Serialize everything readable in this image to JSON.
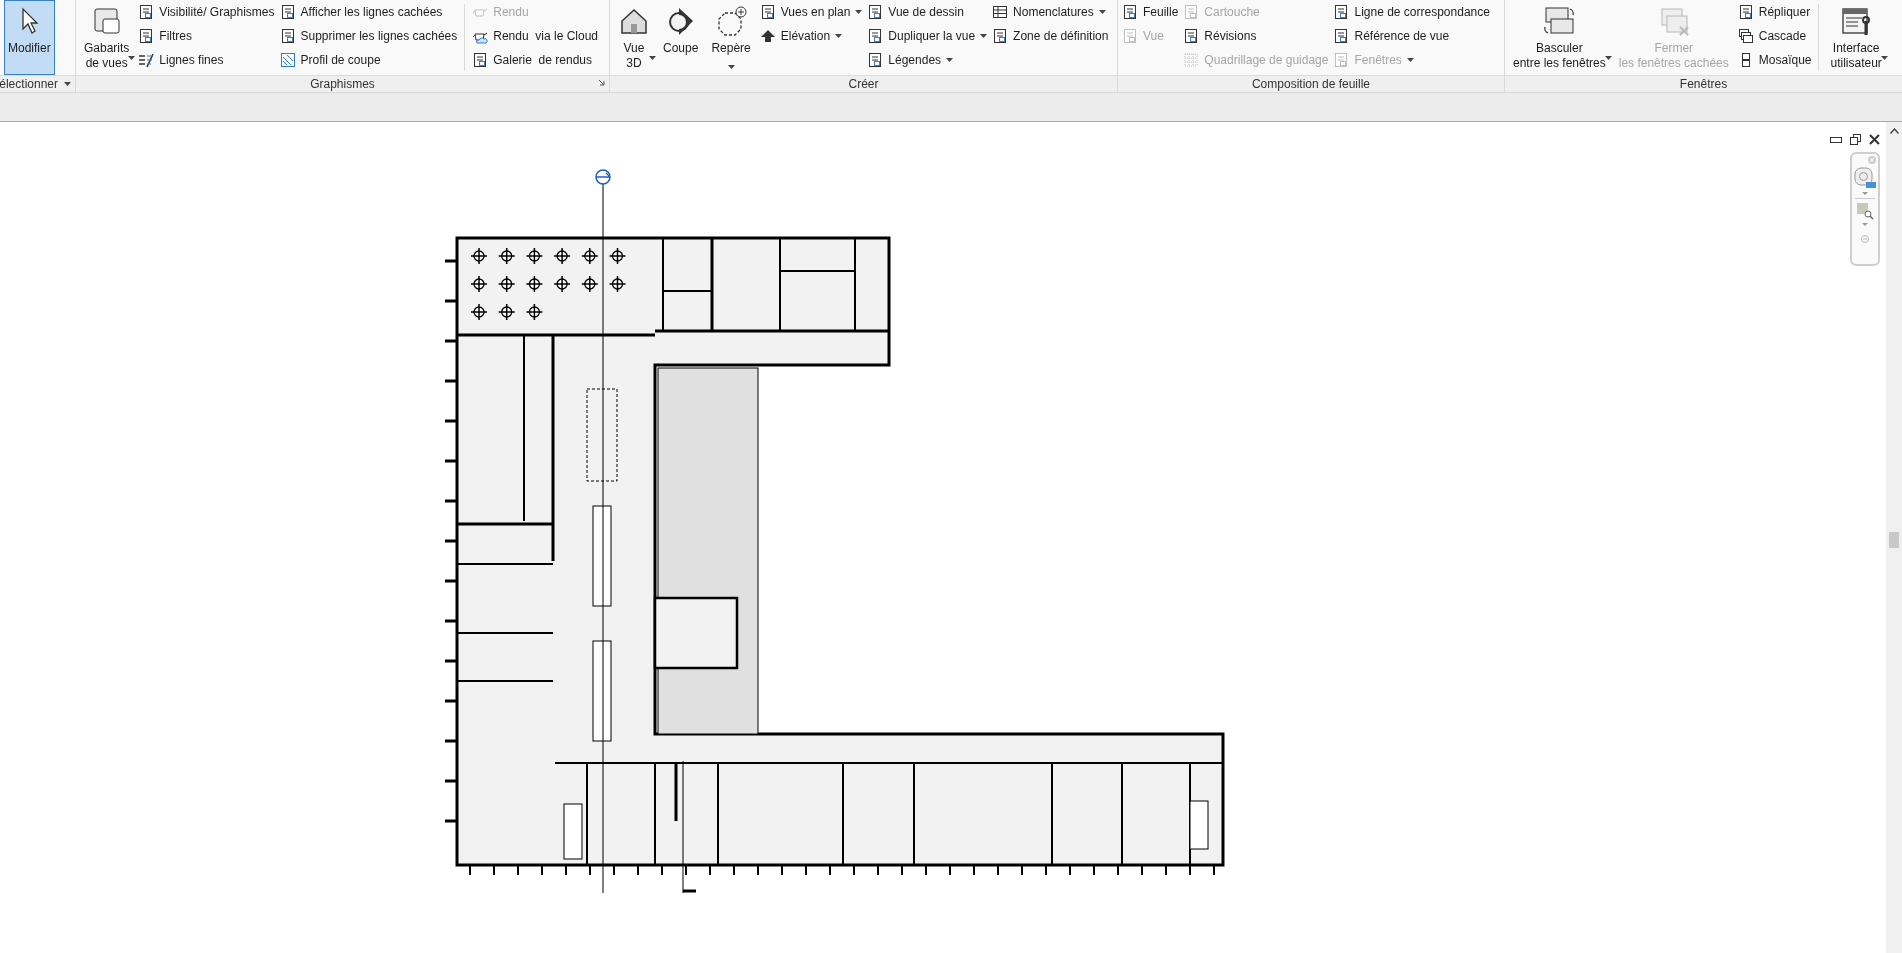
{
  "ribbon": {
    "panels": [
      {
        "title": "électionner",
        "menu": true,
        "launcher": false,
        "columns": [
          {
            "kind": "large",
            "selected": true,
            "disabled": false,
            "dropdown": false,
            "lines": [
              "Modifier"
            ]
          }
        ]
      },
      {
        "title": "Graphismes",
        "menu": false,
        "launcher": true,
        "columns": [
          {
            "kind": "large",
            "selected": false,
            "disabled": false,
            "dropdown": true,
            "lines": [
              "Gabarits",
              "de vues"
            ]
          },
          {
            "kind": "stack",
            "items": [
              {
                "label": "Visibilité/ Graphismes",
                "disabled": false,
                "dropdown": false
              },
              {
                "label": "Filtres",
                "disabled": false,
                "dropdown": false
              },
              {
                "label": "Lignes fines",
                "disabled": false,
                "dropdown": false
              }
            ]
          },
          {
            "kind": "stack",
            "items": [
              {
                "label": "Afficher les lignes cachées",
                "disabled": false,
                "dropdown": false
              },
              {
                "label": "Supprimer les lignes cachées",
                "disabled": false,
                "dropdown": false
              },
              {
                "label": "Profil de coupe",
                "disabled": false,
                "dropdown": false
              }
            ]
          },
          {
            "kind": "separator"
          },
          {
            "kind": "stack",
            "items": [
              {
                "label": "Rendu",
                "disabled": true,
                "dropdown": false
              },
              {
                "label": "Rendu  via le Cloud",
                "disabled": false,
                "dropdown": false
              },
              {
                "label": "Galerie  de rendus",
                "disabled": false,
                "dropdown": false
              }
            ]
          }
        ]
      },
      {
        "title": "Créer",
        "menu": false,
        "launcher": false,
        "columns": [
          {
            "kind": "large",
            "selected": false,
            "disabled": false,
            "dropdown": true,
            "lines": [
              "Vue",
              "3D"
            ]
          },
          {
            "kind": "large",
            "selected": false,
            "disabled": false,
            "dropdown": false,
            "lines": [
              "Coupe"
            ]
          },
          {
            "kind": "large",
            "selected": false,
            "disabled": false,
            "dropdown": true,
            "lines": [
              "Repère"
            ]
          },
          {
            "kind": "stack",
            "items": [
              {
                "label": "Vues en plan",
                "disabled": false,
                "dropdown": true
              },
              {
                "label": "Elévation",
                "disabled": false,
                "dropdown": true
              }
            ]
          },
          {
            "kind": "stack",
            "items": [
              {
                "label": "Vue de dessin",
                "disabled": false,
                "dropdown": false
              },
              {
                "label": "Dupliquer la vue",
                "disabled": false,
                "dropdown": true
              },
              {
                "label": "Légendes",
                "disabled": false,
                "dropdown": true
              }
            ]
          },
          {
            "kind": "stack",
            "items": [
              {
                "label": "Nomenclatures",
                "disabled": false,
                "dropdown": true
              },
              {
                "label": "Zone de définition",
                "disabled": false,
                "dropdown": false
              }
            ]
          }
        ]
      },
      {
        "title": "Composition de feuille",
        "menu": false,
        "launcher": false,
        "columns": [
          {
            "kind": "stack",
            "items": [
              {
                "label": "Feuille",
                "disabled": false,
                "dropdown": false
              },
              {
                "label": "Vue",
                "disabled": true,
                "dropdown": false
              }
            ]
          },
          {
            "kind": "stack",
            "items": [
              {
                "label": "Cartouche",
                "disabled": true,
                "dropdown": false
              },
              {
                "label": "Révisions",
                "disabled": false,
                "dropdown": false
              },
              {
                "label": "Quadrillage de guidage",
                "disabled": true,
                "dropdown": false
              }
            ]
          },
          {
            "kind": "stack",
            "items": [
              {
                "label": "Ligne de correspondance",
                "disabled": false,
                "dropdown": false
              },
              {
                "label": "Référence de vue",
                "disabled": false,
                "dropdown": false
              },
              {
                "label": "Fenêtres",
                "disabled": true,
                "dropdown": true
              }
            ]
          }
        ]
      },
      {
        "title": "Fenêtres",
        "menu": false,
        "launcher": false,
        "columns": [
          {
            "kind": "large",
            "selected": false,
            "disabled": false,
            "dropdown": true,
            "lines": [
              "Basculer",
              "entre les fenêtres"
            ]
          },
          {
            "kind": "large",
            "selected": false,
            "disabled": true,
            "dropdown": false,
            "lines": [
              "Fermer",
              "les fenêtres cachées"
            ]
          },
          {
            "kind": "stack",
            "items": [
              {
                "label": "Répliquer",
                "disabled": false,
                "dropdown": false
              },
              {
                "label": "Cascade",
                "disabled": false,
                "dropdown": false
              },
              {
                "label": "Mosaïque",
                "disabled": false,
                "dropdown": false
              }
            ]
          },
          {
            "kind": "separator"
          },
          {
            "kind": "large",
            "selected": false,
            "disabled": false,
            "dropdown": true,
            "lines": [
              "Interface",
              "utilisateur"
            ]
          }
        ]
      }
    ]
  }
}
